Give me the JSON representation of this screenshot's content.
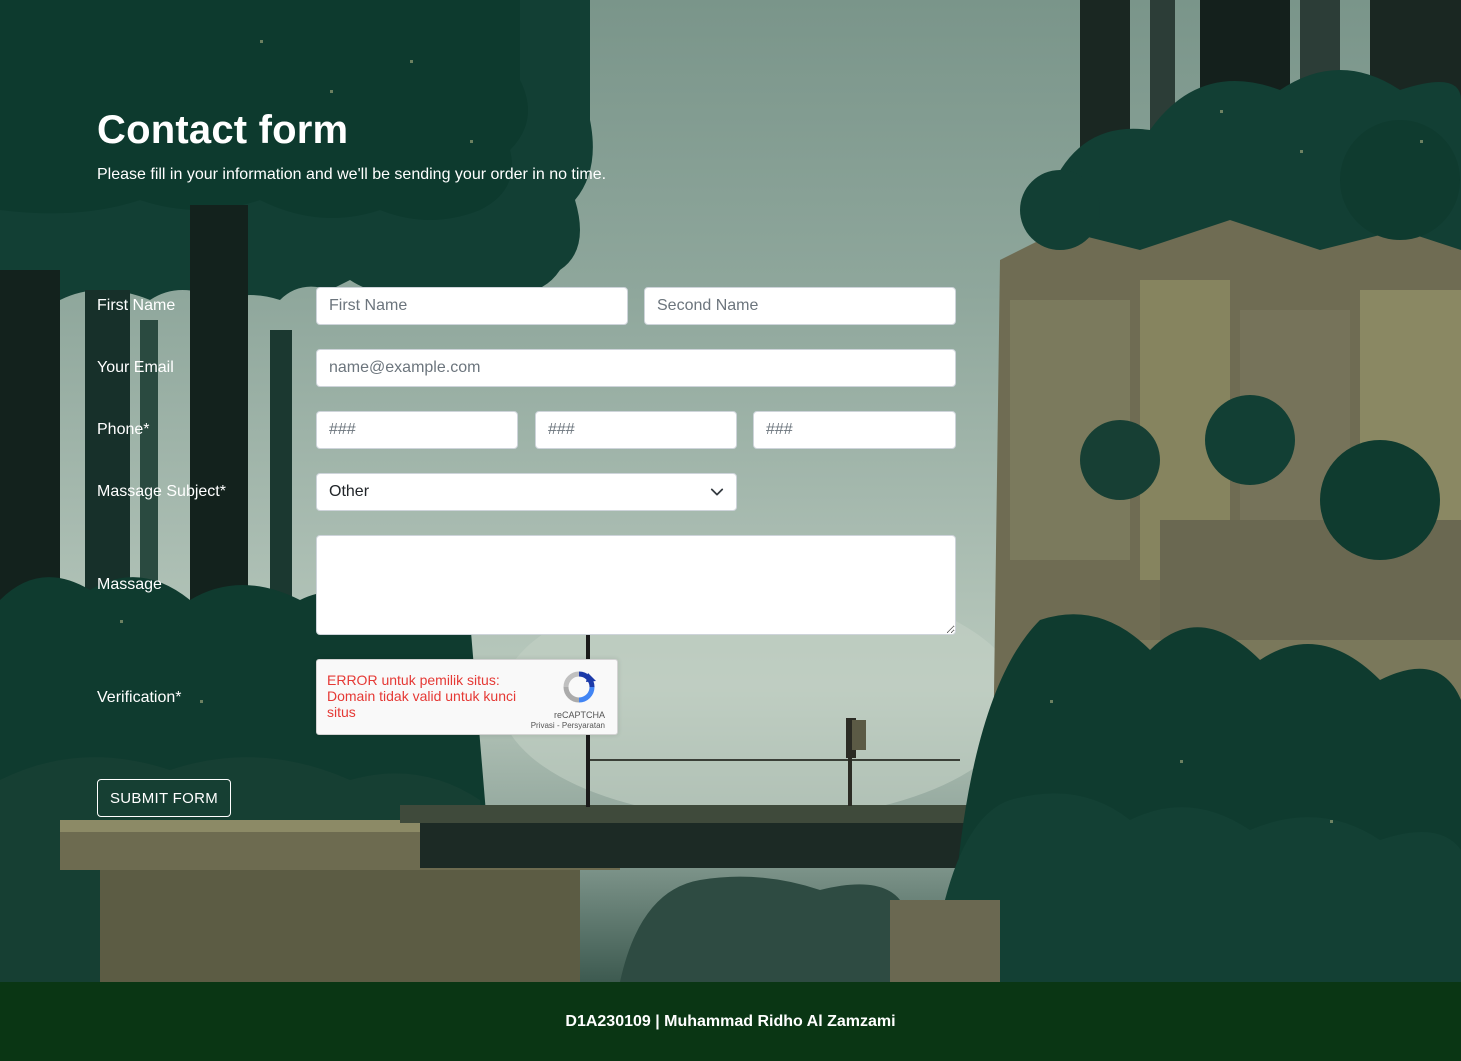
{
  "header": {
    "title": "Contact form",
    "subtitle": "Please fill in your information and we'll be sending your order in no time."
  },
  "form": {
    "name_label": "First Name",
    "first_name_placeholder": "First Name",
    "second_name_placeholder": "Second Name",
    "email_label": "Your Email",
    "email_placeholder": "name@example.com",
    "phone_label": "Phone*",
    "phone_placeholders": [
      "###",
      "###",
      "###"
    ],
    "subject_label": "Massage Subject*",
    "subject_selected": "Other",
    "message_label": "Massage",
    "message_value": "",
    "verification_label": "Verification*",
    "submit_label": "SUBMIT FORM"
  },
  "captcha": {
    "error_text": "ERROR untuk pemilik situs: Domain tidak valid untuk kunci situs",
    "brand": "reCAPTCHA",
    "privacy_link": "Privasi",
    "separator": "-",
    "terms_link": "Persyaratan"
  },
  "footer": {
    "text": "D1A230109 | Muhammad Ridho Al Zamzami"
  },
  "colors": {
    "footer_bg": "#0a3614",
    "forest_dark": "#0c3a30",
    "captcha_error": "#e53935"
  },
  "icons": {
    "select_arrow": "chevron-down-icon",
    "captcha_logo": "recaptcha-icon"
  }
}
